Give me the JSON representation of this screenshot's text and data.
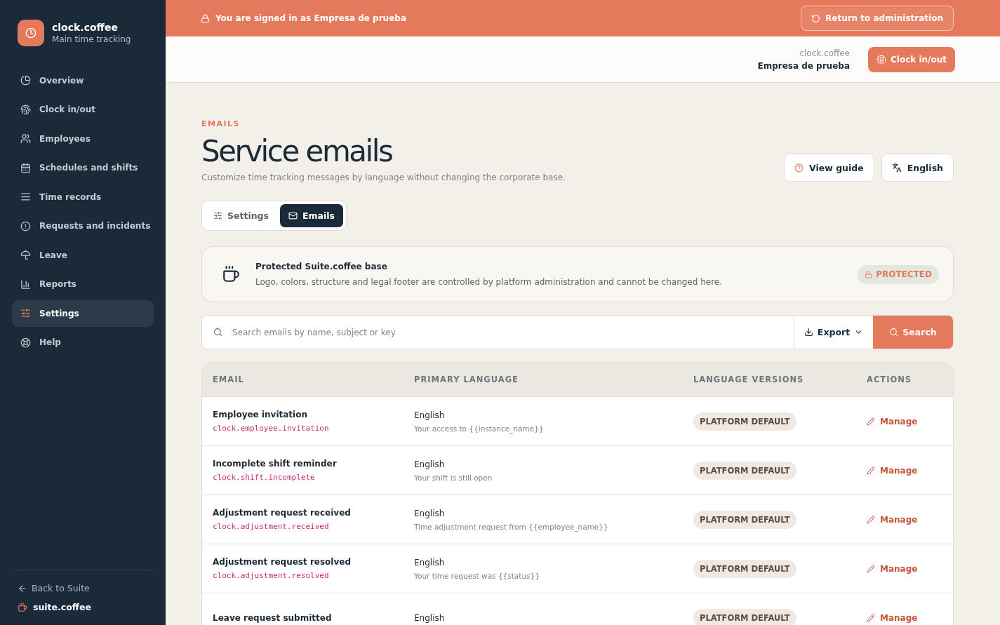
{
  "sidebar": {
    "brand": {
      "name": "clock.coffee",
      "subtitle": "Main time tracking"
    },
    "items": [
      {
        "label": "Overview",
        "selected": false
      },
      {
        "label": "Clock in/out",
        "selected": false
      },
      {
        "label": "Employees",
        "selected": false
      },
      {
        "label": "Schedules and shifts",
        "selected": false
      },
      {
        "label": "Time records",
        "selected": false
      },
      {
        "label": "Requests and incidents",
        "selected": false
      },
      {
        "label": "Leave",
        "selected": false
      },
      {
        "label": "Reports",
        "selected": false
      },
      {
        "label": "Settings",
        "selected": true
      },
      {
        "label": "Help",
        "selected": false
      }
    ],
    "back_link": "Back to Suite",
    "suite_brand": "suite.coffee"
  },
  "banner": {
    "text": "You are signed in as Empresa de prueba",
    "button": "Return to administration"
  },
  "header": {
    "app": "clock.coffee",
    "company": "Empresa de prueba",
    "button": "Clock in/out"
  },
  "page": {
    "eyebrow": "EMAILS",
    "title": "Service emails",
    "subtitle": "Customize time tracking messages by language without changing the corporate base.",
    "buttons": [
      "View guide",
      "English"
    ]
  },
  "tabs": [
    {
      "label": "Settings",
      "selected": false
    },
    {
      "label": "Emails",
      "selected": true
    }
  ],
  "notice": {
    "title": "Protected Suite.coffee base",
    "text": "Logo, colors, structure and legal footer are controlled by platform administration and cannot be changed here.",
    "badge": "PROTECTED"
  },
  "search": {
    "placeholder": "Search emails by name, subject or key",
    "export": "Export",
    "button": "Search"
  },
  "table": {
    "columns": [
      "EMAIL",
      "PRIMARY LANGUAGE",
      "LANGUAGE VERSIONS",
      "ACTIONS"
    ],
    "rows": [
      {
        "name": "Employee invitation",
        "key": "clock.employee.invitation",
        "language": "English",
        "subject": "Your access to {{instance_name}}",
        "versions": "PLATFORM DEFAULT",
        "action": "Manage"
      },
      {
        "name": "Incomplete shift reminder",
        "key": "clock.shift.incomplete",
        "language": "English",
        "subject": "Your shift is still open",
        "versions": "PLATFORM DEFAULT",
        "action": "Manage"
      },
      {
        "name": "Adjustment request received",
        "key": "clock.adjustment.received",
        "language": "English",
        "subject": "Time adjustment request from {{employee_name}}",
        "versions": "PLATFORM DEFAULT",
        "action": "Manage"
      },
      {
        "name": "Adjustment request resolved",
        "key": "clock.adjustment.resolved",
        "language": "English",
        "subject": "Your time request was {{status}}",
        "versions": "PLATFORM DEFAULT",
        "action": "Manage"
      },
      {
        "name": "Leave request submitted",
        "language": "English",
        "versions": "PLATFORM DEFAULT",
        "action": "Manage"
      }
    ]
  }
}
